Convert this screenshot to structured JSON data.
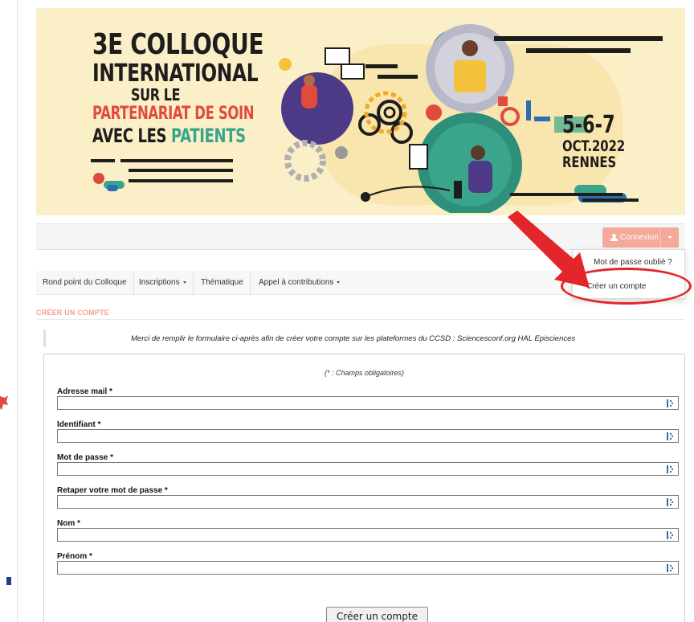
{
  "banner": {
    "title_line1": "3E COLLOQUE",
    "title_line2": "INTERNATIONAL",
    "title_line3": "SUR LE",
    "title_line4": "PARTENARIAT DE SOIN",
    "title_line5_a": "AVEC LES ",
    "title_line5_b": "PATIENTS",
    "dates_line1": "5-6-7",
    "dates_line2": "OCT.2022",
    "dates_line3": "RENNES",
    "colors": {
      "background": "#fbefc8",
      "red": "#e14b3b",
      "green": "#3aa58b",
      "dark": "#1d1d1b"
    }
  },
  "header": {
    "login_label": "Connexion",
    "login_color": "#f4a99a"
  },
  "dropdown": {
    "items": [
      "Mot de passe oublié ?",
      "Créer un compte"
    ]
  },
  "nav": {
    "items": [
      {
        "label": "Rond point du Colloque",
        "has_menu": false
      },
      {
        "label": "Inscriptions",
        "has_menu": true
      },
      {
        "label": "Thématique",
        "has_menu": false
      },
      {
        "label": "Appel à contributions",
        "has_menu": true
      }
    ]
  },
  "page": {
    "section_title": "CRÉER UN COMPTE",
    "info_text": "Merci de remplir le formulaire ci-après afin de créer votre compte sur les plateformes du CCSD : Sciencesconf.org HAL Episciences"
  },
  "form": {
    "required_note": "(* : Champs obligatoires)",
    "fields": [
      {
        "label": "Adresse mail *",
        "value": ""
      },
      {
        "label": "Identifiant *",
        "value": ""
      },
      {
        "label": "Mot de passe *",
        "value": ""
      },
      {
        "label": "Retaper votre mot de passe *",
        "value": ""
      },
      {
        "label": "Nom *",
        "value": ""
      },
      {
        "label": "Prénom *",
        "value": ""
      }
    ],
    "submit_label": "Créer un compte"
  },
  "annotation": {
    "highlight_color": "#e3262b"
  }
}
